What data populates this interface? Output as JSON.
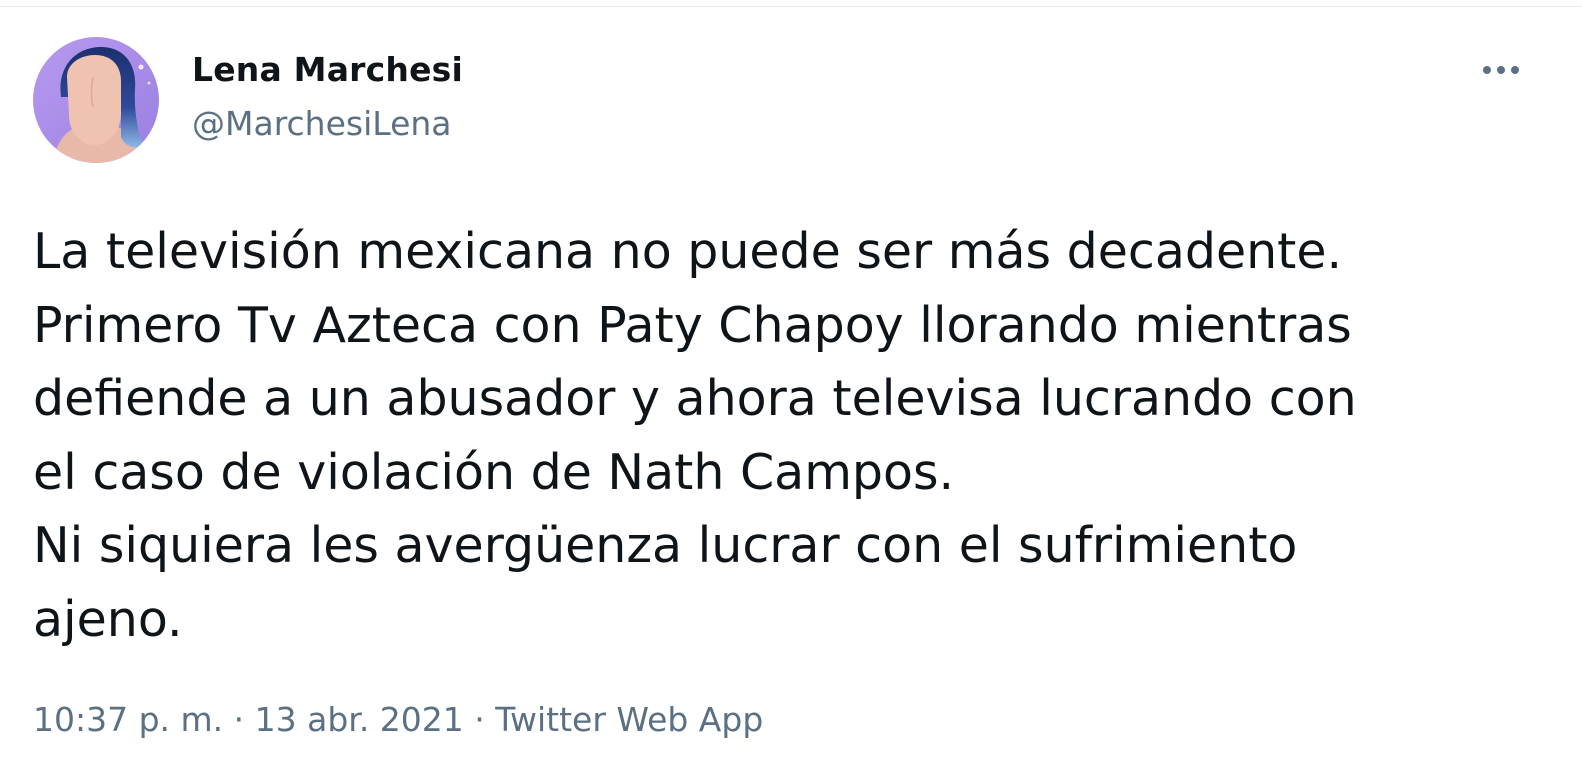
{
  "tweet": {
    "author": {
      "display_name": "Lena Marchesi",
      "handle": "@MarchesiLena",
      "avatar_icon": "profile-avatar-illustration"
    },
    "more_icon": "more-horizontal-icon",
    "text": "La televisión mexicana no puede ser más decadente.\nPrimero Tv Azteca con Paty Chapoy llorando mientras\ndefiende a un abusador y ahora televisa lucrando con\nel caso de violación de Nath Campos.\nNi siquiera les avergüenza lucrar con el sufrimiento\najeno.",
    "meta": {
      "time": "10:37 p. m.",
      "separator": " · ",
      "date": "13 abr. 2021",
      "source": "Twitter Web App"
    }
  },
  "colors": {
    "text_primary": "#0f1419",
    "text_secondary": "#5b7083",
    "avatar_bg": "#a98ce8",
    "border": "#e6ecf0"
  }
}
